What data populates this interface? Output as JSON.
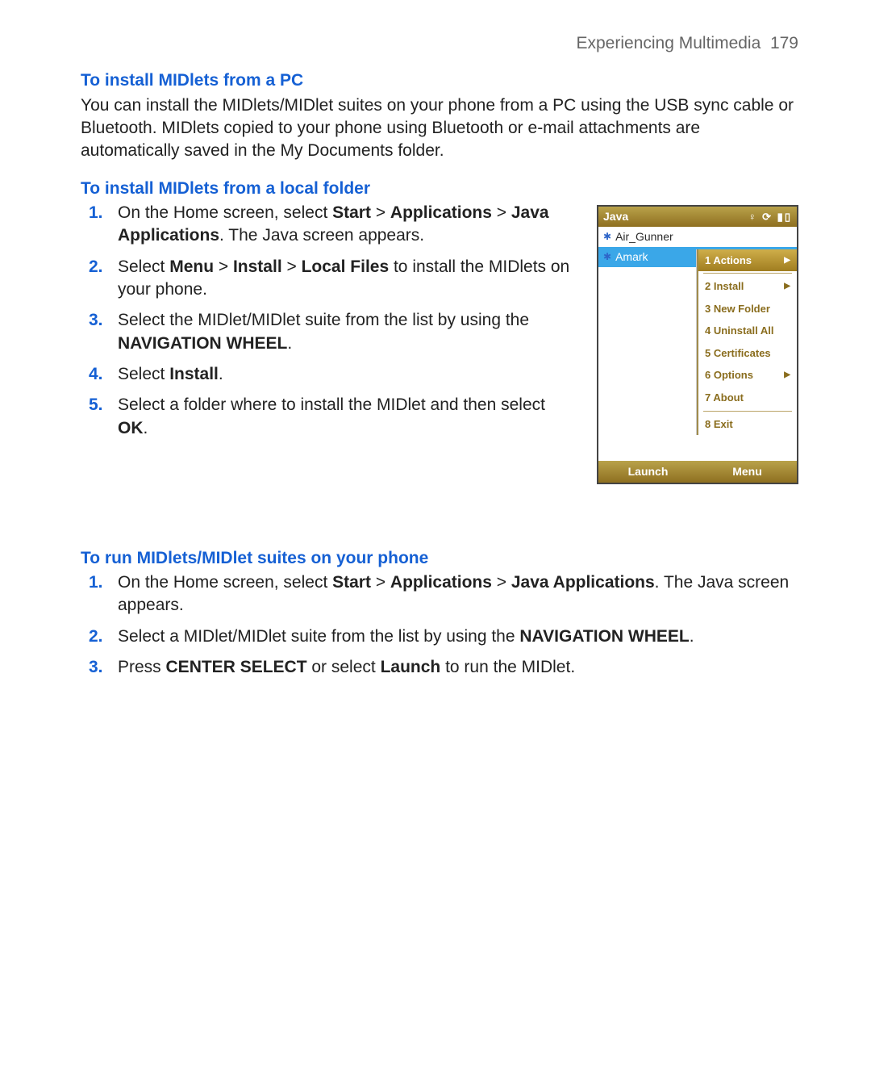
{
  "header": {
    "section": "Experiencing Multimedia",
    "page": "179"
  },
  "sec1": {
    "heading": "To install MIDlets from a PC",
    "body": "You can install the MIDlets/MIDlet suites on your phone from a PC using the USB sync cable or Bluetooth. MIDlets copied to your phone using Bluetooth or e-mail attachments are automatically saved in the My Documents folder."
  },
  "sec2": {
    "heading": "To install MIDlets from a local folder",
    "steps": {
      "s1a": "On the Home screen, select ",
      "s1b": "Start",
      "s1c": " > ",
      "s1d": "Applications",
      "s1e": " > ",
      "s1f": "Java Applications",
      "s1g": ".  The Java screen appears.",
      "s2a": "Select ",
      "s2b": "Menu",
      "s2c": " > ",
      "s2d": "Install",
      "s2e": " > ",
      "s2f": "Local Files",
      "s2g": " to install the MIDlets on your phone.",
      "s3a": "Select the MIDlet/MIDlet suite from the list by using the ",
      "s3b": "NAVIGATION WHEEL",
      "s3c": ".",
      "s4a": "Select ",
      "s4b": "Install",
      "s4c": ".",
      "s5a": "Select a folder where to install the MIDlet and then select ",
      "s5b": "OK",
      "s5c": "."
    }
  },
  "sec3": {
    "heading": "To run MIDlets/MIDlet suites on your phone",
    "steps": {
      "s1a": "On the Home screen, select ",
      "s1b": "Start",
      "s1c": " > ",
      "s1d": "Applications",
      "s1e": " > ",
      "s1f": "Java Applications",
      "s1g": ". The Java screen appears.",
      "s2a": "Select a MIDlet/MIDlet suite from the list by using the ",
      "s2b": "NAVIGATION WHEEL",
      "s2c": ".",
      "s3a": "Press ",
      "s3b": "CENTER SELECT",
      "s3c": " or select ",
      "s3d": "Launch",
      "s3e": " to run the MIDlet."
    }
  },
  "nums": {
    "n1": "1.",
    "n2": "2.",
    "n3": "3.",
    "n4": "4.",
    "n5": "5."
  },
  "phone": {
    "title": "Java",
    "status_icons": "♀ ⟳ ▮▯",
    "item1": "Air_Gunner",
    "item2": "Amark",
    "menu": {
      "m1": "1 Actions",
      "m2": "2 Install",
      "m3": "3 New Folder",
      "m4": "4 Uninstall All",
      "m5": "5 Certificates",
      "m6": "6 Options",
      "m7": "7 About",
      "m8": "8 Exit"
    },
    "soft_left": "Launch",
    "soft_right": "Menu",
    "arrow": "▶"
  }
}
